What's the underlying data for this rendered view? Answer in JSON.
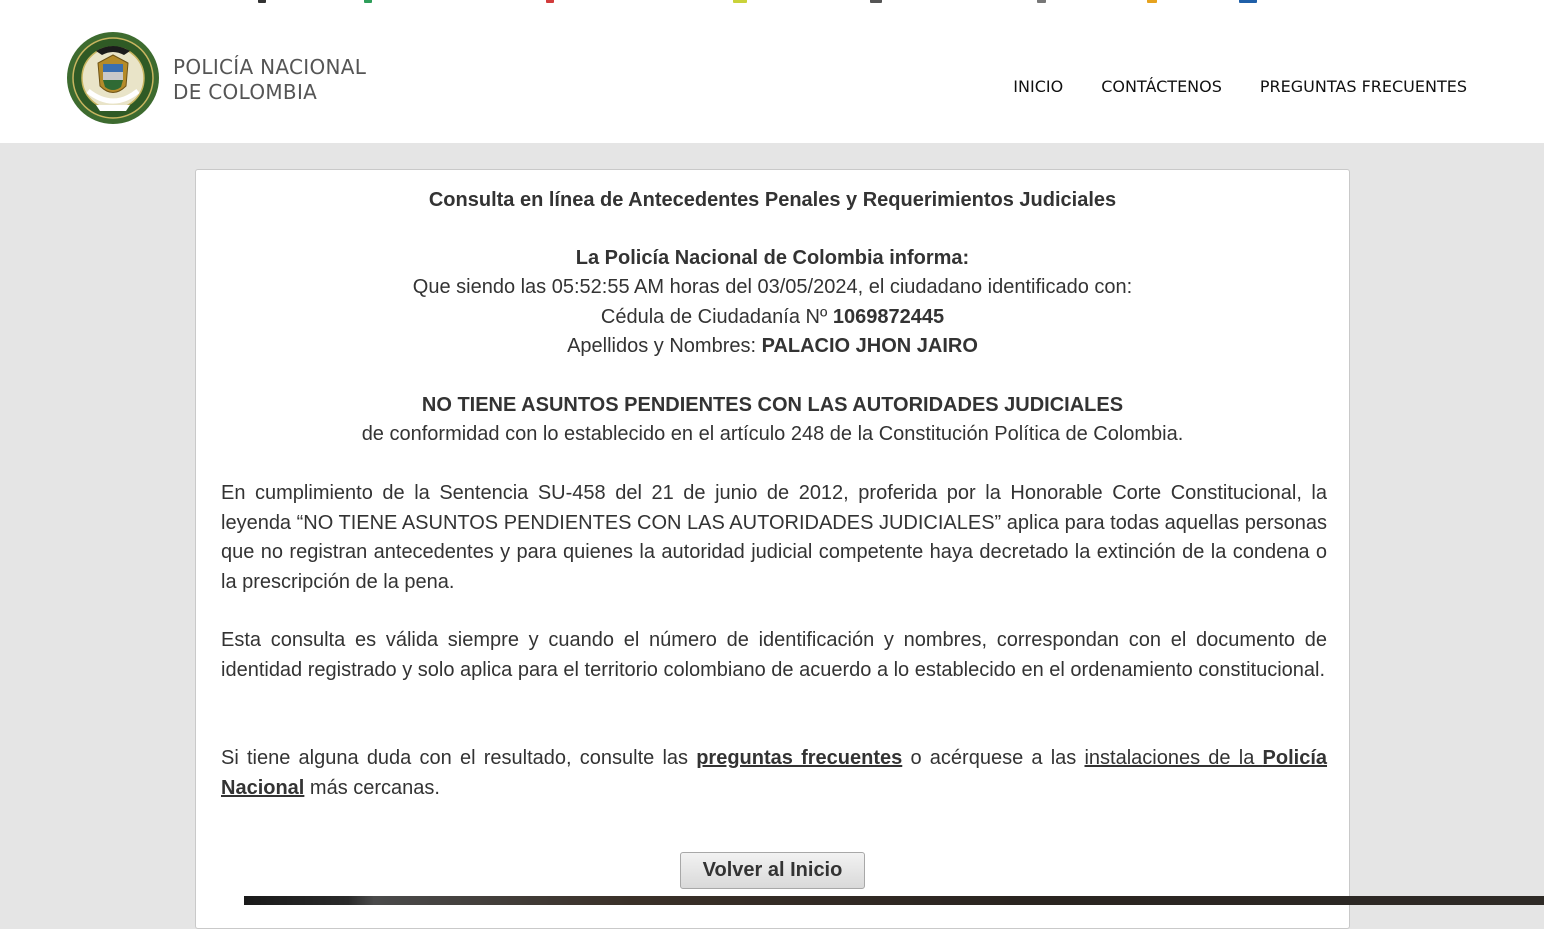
{
  "header": {
    "brand_line1": "POLICÍA NACIONAL",
    "brand_line2": "DE COLOMBIA",
    "nav": [
      {
        "label": "INICIO"
      },
      {
        "label": "CONTÁCTENOS"
      },
      {
        "label": "PREGUNTAS FRECUENTES"
      }
    ]
  },
  "result": {
    "title": "Consulta en línea de Antecedentes Penales y Requerimientos Judiciales",
    "informa": "La Policía Nacional de Colombia informa:",
    "line_prefix": "Que siendo las",
    "time": "05:52:55 AM",
    "line_mid": "horas del",
    "date": "03/05/2024",
    "line_suffix": ", el ciudadano identificado con:",
    "cedula_label": "Cédula de Ciudadanía Nº",
    "cedula_number": "1069872445",
    "names_label": "Apellidos y Nombres:",
    "names_value": "PALACIO JHON JAIRO",
    "status": "NO TIENE ASUNTOS PENDIENTES CON LAS AUTORIDADES JUDICIALES",
    "status_note": "de conformidad con lo establecido en el artículo 248 de la Constitución Política de Colombia.",
    "para1": "En cumplimiento de la Sentencia SU-458 del 21 de junio de 2012, proferida por la Honorable Corte Constitucional, la leyenda “NO TIENE ASUNTOS PENDIENTES CON LAS AUTORIDADES JUDICIALES” aplica para todas aquellas personas que no registran antecedentes y para quienes la autoridad judicial competente haya decretado la extinción de la condena o la prescripción de la pena.",
    "para2": "Esta consulta es válida siempre y cuando el número de identificación y nombres, correspondan con el documento de identidad registrado y solo aplica para el territorio colombiano de acuerdo a lo establecido en el ordenamiento constitucional.",
    "para3_a": "Si tiene alguna duda con el resultado, consulte las ",
    "para3_link1": "preguntas frecuentes",
    "para3_b": " o acérquese a las ",
    "para3_link2_a": "instalaciones de la ",
    "para3_link2_b": "Policía Nacional",
    "para3_c": " más cercanas.",
    "button": "Volver al Inicio"
  },
  "colors": {
    "page_bg": "#e5e5e5",
    "text": "#333333",
    "seal_green": "#3d6b2f"
  }
}
